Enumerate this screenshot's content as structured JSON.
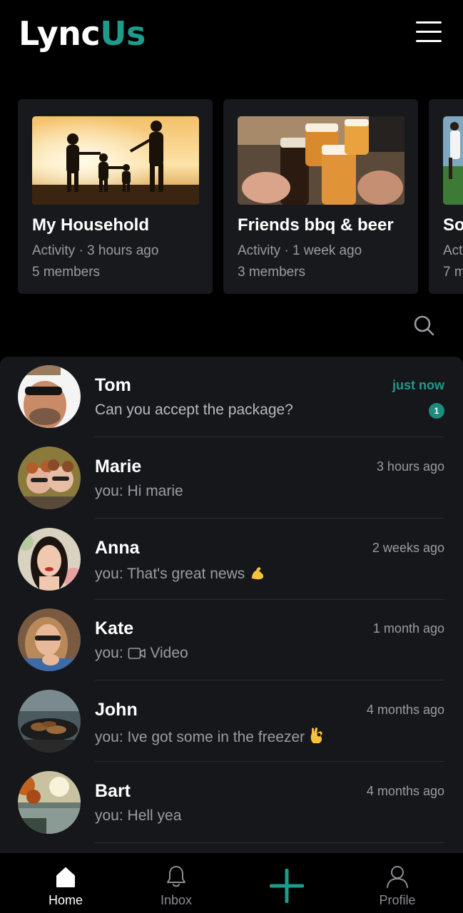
{
  "app": {
    "logo_part1": "Lync",
    "logo_part2": "Us"
  },
  "groups": [
    {
      "title": "My Household",
      "activity": "Activity · 3 hours ago",
      "members": "5 members"
    },
    {
      "title": "Friends bbq & beer",
      "activity": "Activity · 1 week ago",
      "members": "3 members"
    },
    {
      "title": "So",
      "activity": "Act",
      "members": "7 m"
    }
  ],
  "chats": [
    {
      "name": "Tom",
      "message": "Can you accept the package?",
      "time": "just now",
      "unread": "1"
    },
    {
      "name": "Marie",
      "message": "you: Hi marie",
      "time": "3 hours ago"
    },
    {
      "name": "Anna",
      "message": "you: That's great news",
      "time": "2 weeks ago",
      "emoji": "flexed-biceps-emoji"
    },
    {
      "name": "Kate",
      "message_prefix": "you:",
      "message": "Video",
      "time": "1 month ago",
      "icon": "video-icon"
    },
    {
      "name": "John",
      "message": "you: Ive got some in the freezer",
      "time": "4 months ago",
      "emoji": "ok-hand-emoji"
    },
    {
      "name": "Bart",
      "message": "you: Hell yea",
      "time": "4 months ago"
    }
  ],
  "nav": {
    "home": "Home",
    "inbox": "Inbox",
    "profile": "Profile"
  },
  "colors": {
    "accent": "#1f9b8c",
    "background": "#000000",
    "list_bg": "#16171a",
    "card_bg": "#18191c"
  }
}
